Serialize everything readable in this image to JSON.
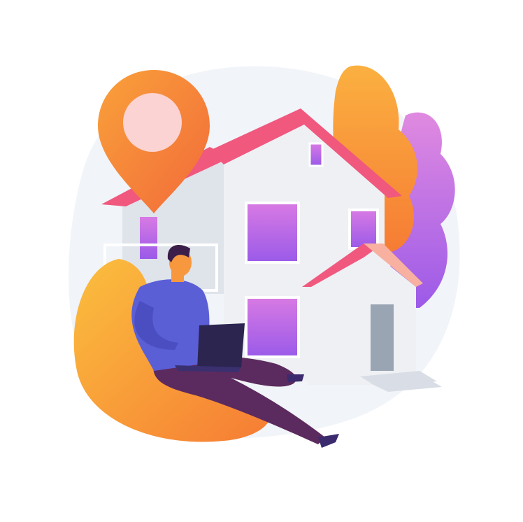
{
  "illustration": {
    "subject": "remote-work-from-home",
    "colors": {
      "background_blob": "#f1f4f8",
      "roof": "#f0587e",
      "house_wall": "#eef0f4",
      "house_shadow": "#d9dde5",
      "window": "#b267e8",
      "door": "#9aa5b3",
      "pin": "#f7843a",
      "pin_center": "#fbd3d3",
      "bean_bag": "#f9a13a",
      "shirt": "#5b5fd6",
      "pants": "#5b2a5e",
      "skin": "#f7983f",
      "hair": "#3b1f4a",
      "laptop": "#2b2550",
      "tree_orange": "#f9a23a",
      "tree_purple": "#c86ae0"
    }
  }
}
